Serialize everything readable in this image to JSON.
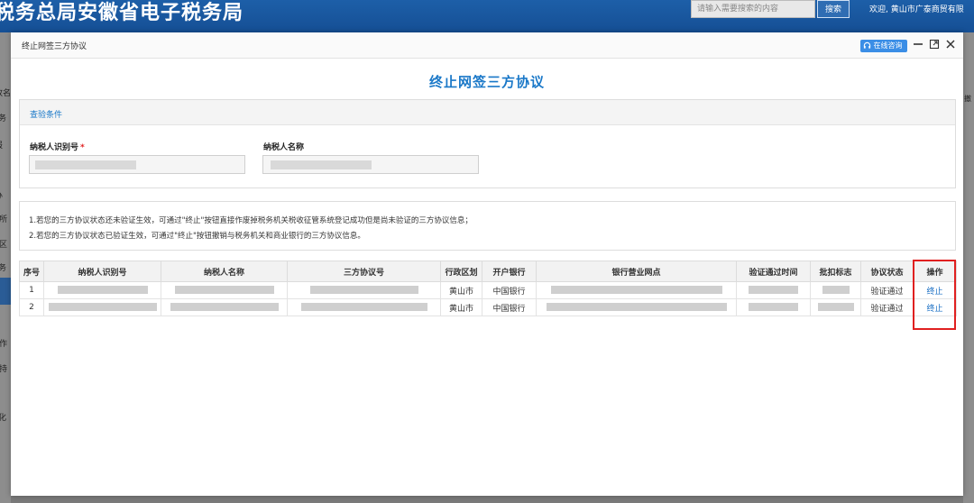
{
  "background": {
    "site_title": "税务总局安徽省电子税务局",
    "search_placeholder": "请输入需要搜索的内容",
    "search_button": "搜索",
    "welcome_text": "欢迎, 黄山市广泰商贸有限",
    "left_fragments": [
      "改名",
      "务",
      "报",
      "办",
      "服所",
      "户区",
      "务",
      "操作",
      "支持",
      "化"
    ],
    "right_fragment": "撤"
  },
  "modal": {
    "window_title": "终止网签三方协议",
    "online_consult": "在线咨询",
    "page_title": "终止网签三方协议",
    "query": {
      "header": "查验条件",
      "taxpayer_id_label": "纳税人识别号",
      "required_mark": "*",
      "taxpayer_name_label": "纳税人名称"
    },
    "notes": [
      "1.若您的三方协议状态还未验证生效，可通过\"终止\"按钮直接作废掉税务机关税收征管系统登记成功但是尚未验证的三方协议信息；",
      "2.若您的三方协议状态已验证生效，可通过\"终止\"按钮撤销与税务机关和商业银行的三方协议信息。"
    ],
    "table": {
      "headers": [
        "序号",
        "纳税人识别号",
        "纳税人名称",
        "三方协议号",
        "行政区划",
        "开户银行",
        "银行营业网点",
        "验证通过时间",
        "批扣标志",
        "协议状态",
        "操作"
      ],
      "rows": [
        {
          "no": "1",
          "region": "黄山市",
          "bank": "中国银行",
          "status": "验证通过",
          "action": "终止"
        },
        {
          "no": "2",
          "region": "黄山市",
          "bank": "中国银行",
          "status": "验证通过",
          "action": "终止"
        }
      ]
    }
  },
  "colors": {
    "accent": "#1a78c8",
    "header_blue": "#1d5fa8",
    "highlight_red": "#e02020"
  }
}
